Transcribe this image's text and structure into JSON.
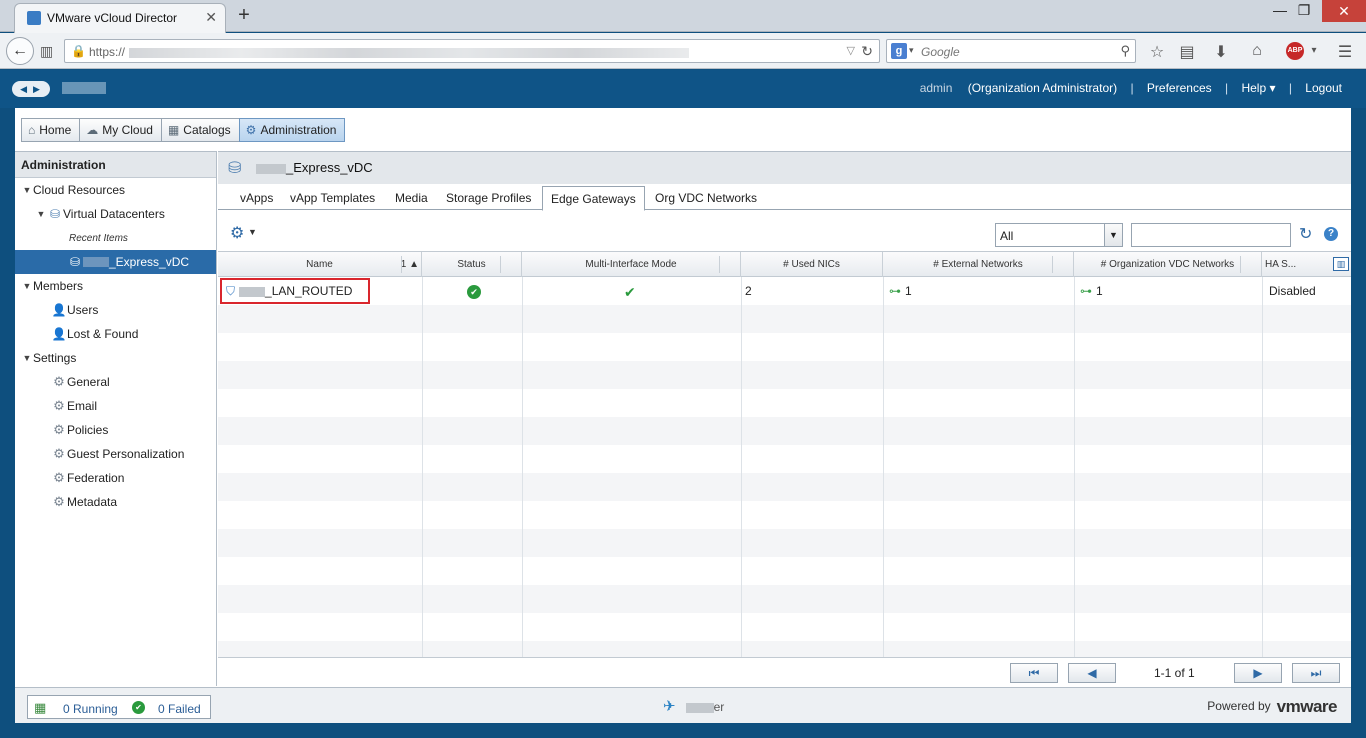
{
  "browser": {
    "tab_title": "VMware vCloud Director",
    "tab_close": "✕",
    "new_tab": "+",
    "url_prefix": "https://",
    "search_placeholder": "Google",
    "abp_label": "ABP"
  },
  "header": {
    "user": "admin",
    "role": "(Organization Administrator)",
    "sep": "|",
    "preferences": "Preferences",
    "help": "Help ▾",
    "logout": "Logout"
  },
  "main_tabs": [
    {
      "label": "Home"
    },
    {
      "label": "My Cloud"
    },
    {
      "label": "Catalogs"
    },
    {
      "label": "Administration"
    }
  ],
  "left_panel": {
    "title": "Administration",
    "cloud_resources": "Cloud Resources",
    "virtual_datacenters": "Virtual Datacenters",
    "recent_items": "Recent Items",
    "vdc_item": "_Express_vDC",
    "members": "Members",
    "users": "Users",
    "lost_found": "Lost & Found",
    "settings": "Settings",
    "settings_items": [
      "General",
      "Email",
      "Policies",
      "Guest Personalization",
      "Federation",
      "Metadata"
    ]
  },
  "right_panel": {
    "title": "_Express_vDC",
    "sub_tabs": [
      "vApps",
      "vApp Templates",
      "Media",
      "Storage Profiles",
      "Edge Gateways",
      "Org VDC Networks"
    ],
    "active_sub_tab": "Edge Gateways",
    "filter_value": "All",
    "filter_arrow": "▼"
  },
  "grid": {
    "columns": [
      "Name",
      "Status",
      "Multi-Interface Mode",
      "# Used NICs",
      "# External Networks",
      "# Organization VDC Networks",
      "HA S..."
    ],
    "sort_indicator": "1 ▲",
    "rows": [
      {
        "name": "_LAN_ROUTED",
        "status": "ok",
        "multi_interface": "✔",
        "used_nics": "2",
        "external_networks": "1",
        "org_vdc_networks": "1",
        "ha_state": "Disabled"
      }
    ]
  },
  "pager": {
    "first": "⏮",
    "prev": "◀",
    "next": "▶",
    "last": "⏭",
    "text": "1-1 of 1"
  },
  "statusbar": {
    "running": "0 Running",
    "failed": "0 Failed",
    "center_suffix": "er",
    "powered_by": "Powered by",
    "brand": "vmware"
  }
}
